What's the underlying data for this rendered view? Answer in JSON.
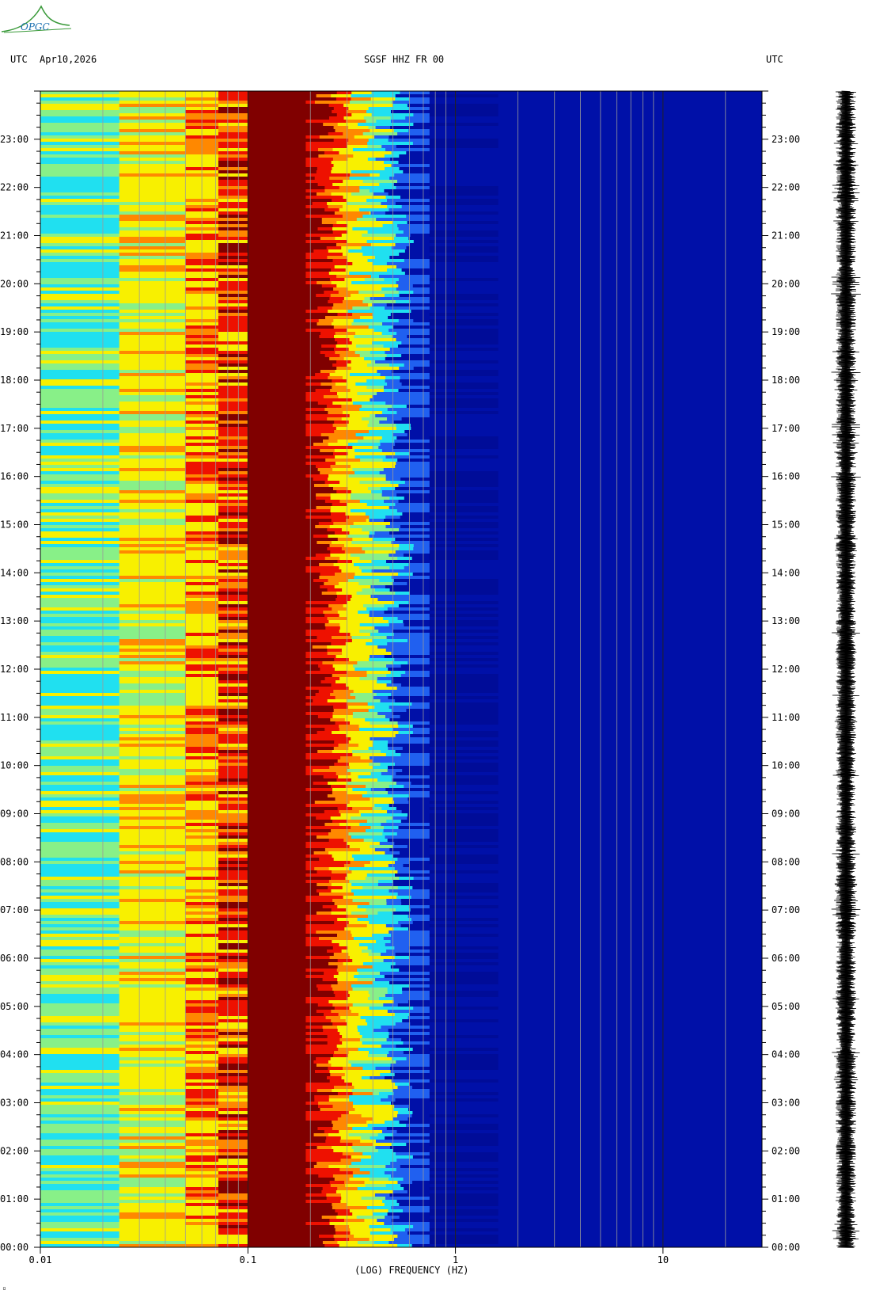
{
  "header": {
    "utc_left": "UTC",
    "date": "Apr10,2026",
    "station": "SGSF HHZ FR 00",
    "utc_right": "UTC"
  },
  "logo": {
    "text": "OPGC"
  },
  "chart_data": {
    "type": "heatmap",
    "title": "SGSF HHZ FR 00",
    "xlabel": "(LOG) FREQUENCY (HZ)",
    "ylabel": "UTC",
    "x_scale": "log",
    "xlim": [
      0.01,
      30
    ],
    "x_ticks": [
      {
        "value": 0.01,
        "label": "0.01"
      },
      {
        "value": 0.1,
        "label": "0.1"
      },
      {
        "value": 1,
        "label": "1"
      },
      {
        "value": 10,
        "label": "10"
      }
    ],
    "ylim_hours": [
      0,
      24
    ],
    "y_ticks": [
      "00:00",
      "01:00",
      "02:00",
      "03:00",
      "04:00",
      "05:00",
      "06:00",
      "07:00",
      "08:00",
      "09:00",
      "10:00",
      "11:00",
      "12:00",
      "13:00",
      "14:00",
      "15:00",
      "16:00",
      "17:00",
      "18:00",
      "19:00",
      "20:00",
      "21:00",
      "22:00",
      "23:00"
    ],
    "frequency_bands": [
      {
        "from": 0.01,
        "to": 0.024,
        "level": "cyan-yellow"
      },
      {
        "from": 0.024,
        "to": 0.072,
        "level": "yellow"
      },
      {
        "from": 0.072,
        "to": 0.1,
        "level": "red-yellow"
      },
      {
        "from": 0.1,
        "to": 0.2,
        "level": "dark-red"
      },
      {
        "from": 0.2,
        "to": 0.3,
        "level": "red-orange"
      },
      {
        "from": 0.3,
        "to": 0.6,
        "level": "yellow-cyan-blue"
      },
      {
        "from": 0.6,
        "to": 30,
        "level": "dark-blue"
      }
    ],
    "colors": {
      "darkred": "#800000",
      "red": "#ee1100",
      "orange": "#ff8800",
      "yellow": "#f8f000",
      "green": "#88f088",
      "cyan": "#20e0f0",
      "blue": "#2060f0",
      "navy": "#0010a8",
      "darknavy": "#000c98"
    },
    "seismogram_color": "#000000"
  }
}
